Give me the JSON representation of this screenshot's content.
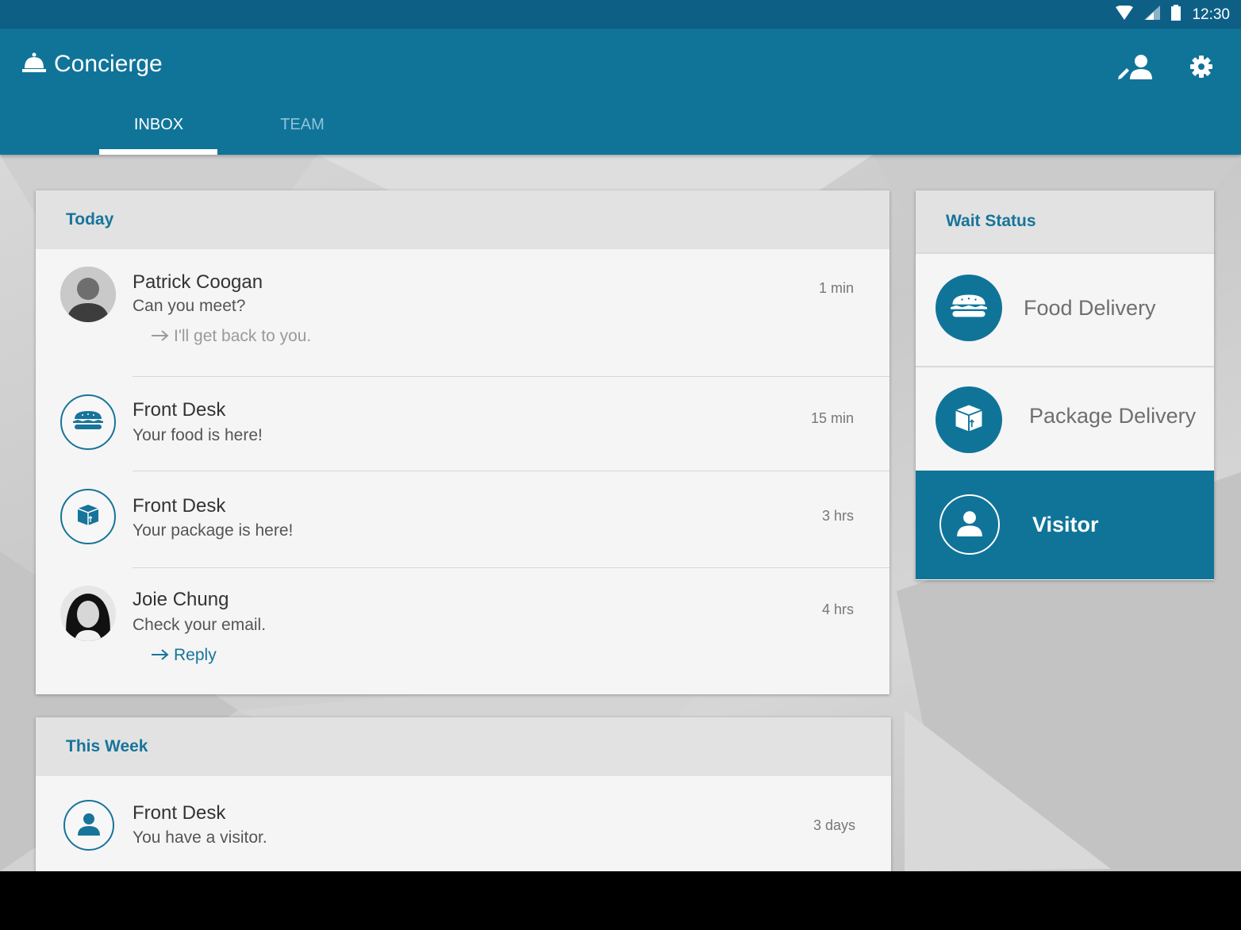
{
  "status_bar": {
    "time": "12:30",
    "icons": [
      "wifi-icon",
      "signal-icon",
      "battery-icon"
    ]
  },
  "app": {
    "title": "Concierge",
    "logo_icon": "bell-icon",
    "actions": [
      "person-edit-icon",
      "gear-icon"
    ]
  },
  "tabs": [
    {
      "label": "INBOX",
      "active": true
    },
    {
      "label": "TEAM",
      "active": false
    }
  ],
  "inbox": {
    "today_label": "Today",
    "week_label": "This Week",
    "today": [
      {
        "sender": "Patrick Coogan",
        "preview": "Can you meet?",
        "reply": "I'll get back to you.",
        "time": "1 min",
        "avatar": "photo"
      },
      {
        "sender": "Front Desk",
        "preview": "Your food is here!",
        "time": "15 min",
        "avatar": "food-icon"
      },
      {
        "sender": "Front Desk",
        "preview": "Your package is here!",
        "time": "3  hrs",
        "avatar": "package-icon"
      },
      {
        "sender": "Joie Chung",
        "preview": "Check your email.",
        "reply": "Reply",
        "time": "4 hrs",
        "avatar": "photo"
      }
    ],
    "week": [
      {
        "sender": "Front Desk",
        "preview": "You have a visitor.",
        "time": "3 days",
        "avatar": "person-icon"
      }
    ]
  },
  "wait_status": {
    "title": "Wait Status",
    "items": [
      {
        "label": "Food Delivery",
        "icon": "food-icon",
        "active": false
      },
      {
        "label": "Package Delivery",
        "icon": "package-icon",
        "active": false
      },
      {
        "label": "Visitor",
        "icon": "person-icon",
        "active": true
      }
    ]
  },
  "colors": {
    "primary": "#107499",
    "status_bar": "#0e5f86",
    "accent_text": "#17749a"
  }
}
